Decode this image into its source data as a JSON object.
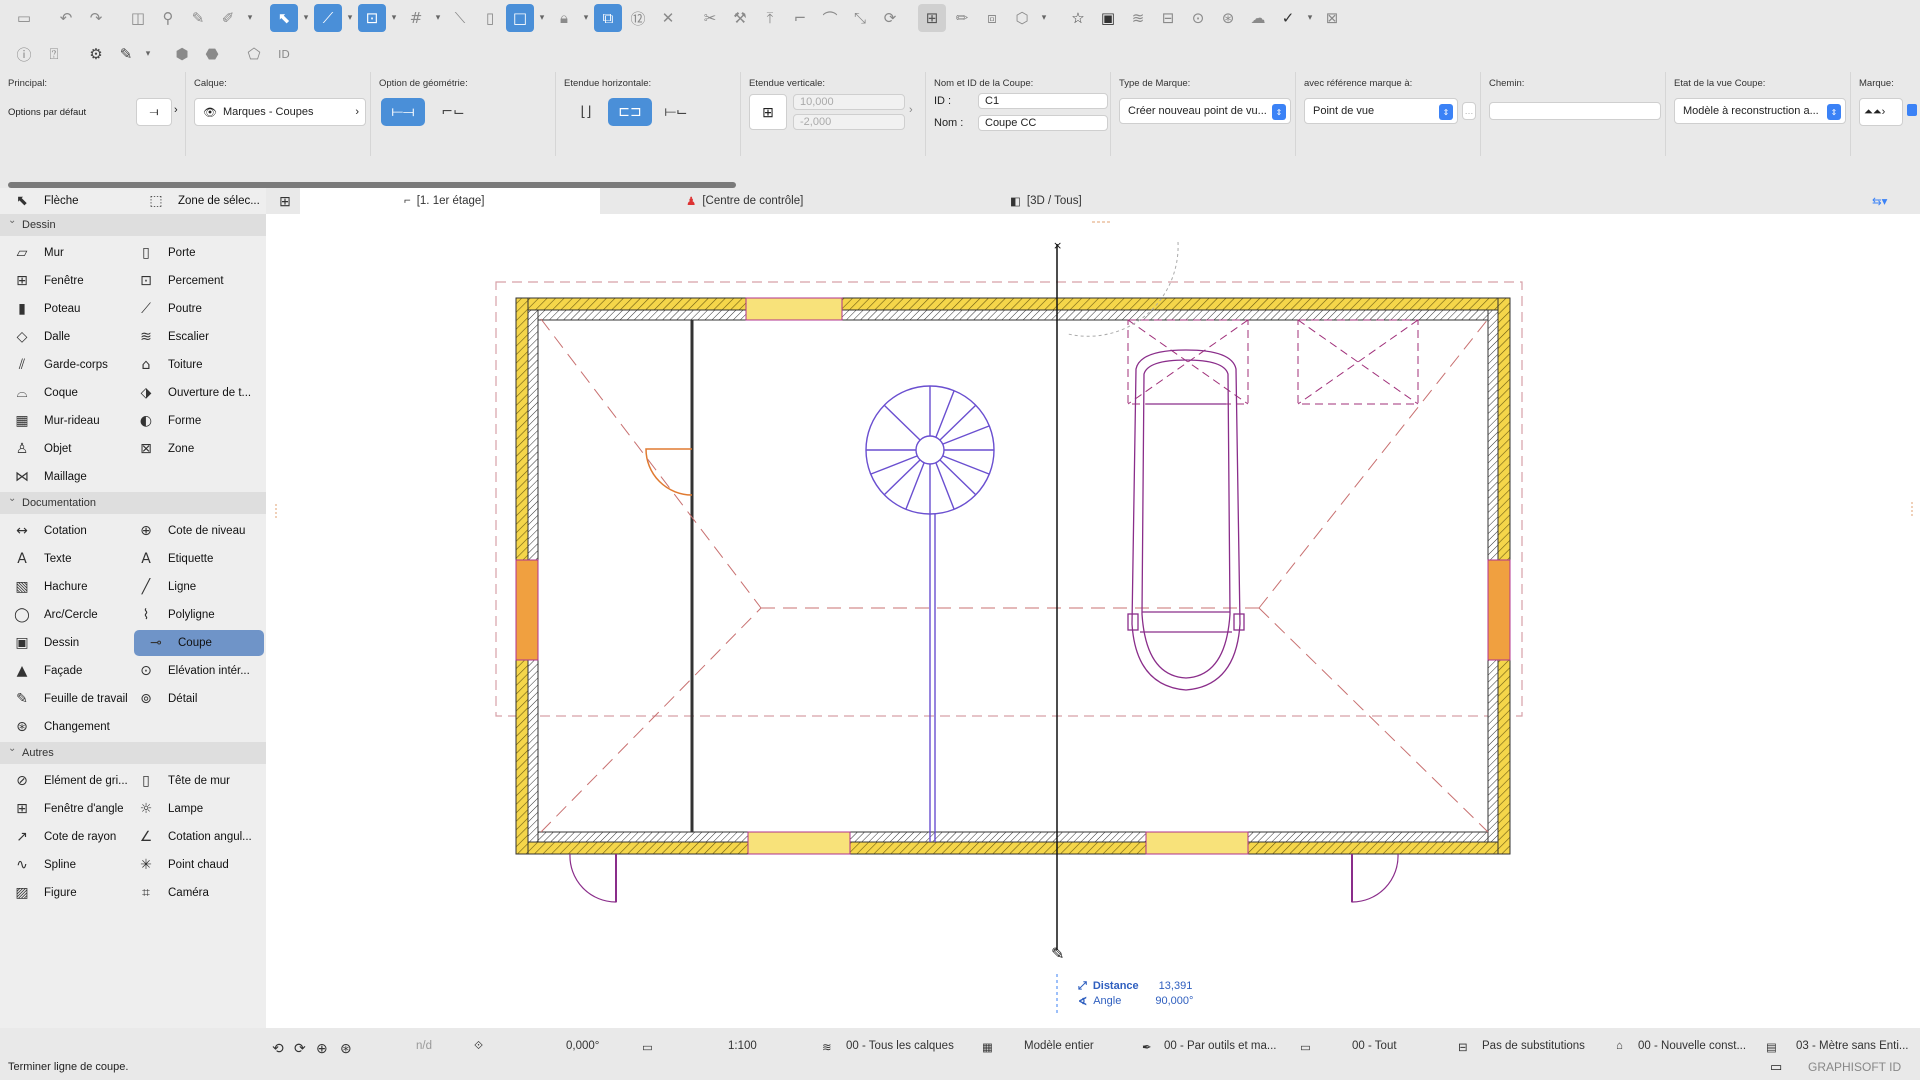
{
  "toolbar1": {
    "icons": [
      "save-icon",
      "undo-icon",
      "redo-icon",
      "pet-palette-icon",
      "magic-wand-icon",
      "pick-up-icon",
      "inject-icon",
      "arrow-tool-icon",
      "guide-line-icon",
      "snap-guide-icon",
      "grid-snap-icon",
      "ruler-icon",
      "layout-icon",
      "lock-icon",
      "trace-icon",
      "number-icon",
      "cancel-icon",
      "scissors-icon",
      "wand-icon",
      "elevate-icon",
      "offset-icon",
      "fillet-icon",
      "resize-icon",
      "rotate-icon",
      "group-icon",
      "edit-icon",
      "element-icon",
      "3d-icon",
      "favorites-icon",
      "view-icon",
      "layers-icon",
      "split-icon",
      "publish-icon",
      "teamwork-icon",
      "sync-icon",
      "check-icon",
      "library-icon"
    ]
  },
  "toolbar2": {
    "icons": [
      "info-icon",
      "help-icon",
      "organizer-icon",
      "pencil-icon",
      "3d-filter-icon",
      "marquee-icon",
      "id-icon"
    ]
  },
  "infobox": {
    "principal": {
      "label": "Principal:",
      "value": "Options par défaut"
    },
    "calque": {
      "label": "Calque:",
      "value": "Marques - Coupes"
    },
    "geometrie": {
      "label": "Option de géométrie:"
    },
    "horizontale": {
      "label": "Etendue horizontale:"
    },
    "verticale": {
      "label": "Etendue verticale:",
      "top": "10,000",
      "bottom": "-2,000"
    },
    "nom": {
      "label": "Nom et ID de la Coupe:",
      "id_label": "ID :",
      "id_value": "C1",
      "nom_label": "Nom :",
      "nom_value": "Coupe CC"
    },
    "type": {
      "label": "Type de Marque:",
      "value": "Créer nouveau point de vu..."
    },
    "ref": {
      "label": "avec référence marque à:",
      "value": "Point de vue"
    },
    "chemin": {
      "label": "Chemin:",
      "value": ""
    },
    "etat": {
      "label": "Etat de la vue Coupe:",
      "value": "Modèle à reconstruction a..."
    },
    "marque": {
      "label": "Marque:"
    }
  },
  "tabs": [
    {
      "label": "[1. 1er étage]"
    },
    {
      "label": "[Centre de contrôle]"
    },
    {
      "label": "[3D / Tous]"
    }
  ],
  "toolbox": {
    "top": [
      {
        "label": "Flèche",
        "icon": "arrow-icon"
      },
      {
        "label": "Zone de sélec...",
        "icon": "marquee-icon"
      }
    ],
    "sections": [
      {
        "title": "Dessin",
        "items": [
          [
            "Mur",
            "Porte"
          ],
          [
            "Fenêtre",
            "Percement"
          ],
          [
            "Poteau",
            "Poutre"
          ],
          [
            "Dalle",
            "Escalier"
          ],
          [
            "Garde-corps",
            "Toiture"
          ],
          [
            "Coque",
            "Ouverture de t..."
          ],
          [
            "Mur-rideau",
            "Forme"
          ],
          [
            "Objet",
            "Zone"
          ],
          [
            "Maillage",
            ""
          ]
        ]
      },
      {
        "title": "Documentation",
        "items": [
          [
            "Cotation",
            "Cote de niveau"
          ],
          [
            "Texte",
            "Etiquette"
          ],
          [
            "Hachure",
            "Ligne"
          ],
          [
            "Arc/Cercle",
            "Polyligne"
          ],
          [
            "Dessin",
            "Coupe"
          ],
          [
            "Façade",
            "Elévation intér..."
          ],
          [
            "Feuille de travail",
            "Détail"
          ],
          [
            "Changement",
            ""
          ]
        ]
      },
      {
        "title": "Autres",
        "items": [
          [
            "Elément de gri...",
            "Tête de mur"
          ],
          [
            "Fenêtre d'angle",
            "Lampe"
          ],
          [
            "Cote de rayon",
            "Cotation angul..."
          ],
          [
            "Spline",
            "Point chaud"
          ],
          [
            "Figure",
            "Caméra"
          ]
        ]
      }
    ]
  },
  "tracker": {
    "distance_label": "Distance",
    "distance_value": "13,391",
    "angle_label": "Angle",
    "angle_value": "90,000°"
  },
  "statusbar": {
    "nd": "n/d",
    "angle": "0,000°",
    "scale": "1:100",
    "layers": "00 - Tous les calques",
    "model": "Modèle entier",
    "pens": "00 - Par outils et ma...",
    "struct": "00 - Tout",
    "subst": "Pas de substitutions",
    "reno": "00 - Nouvelle const...",
    "dim": "03 - Mètre sans Enti..."
  },
  "footer": {
    "message": "Terminer ligne de coupe.",
    "brand": "GRAPHISOFT ID"
  }
}
